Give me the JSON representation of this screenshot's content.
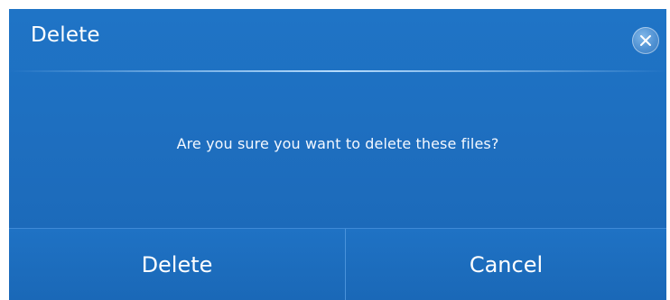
{
  "dialog": {
    "title": "Delete",
    "message": "Are you sure you want to delete these files?",
    "close_icon": "close-circle-icon",
    "buttons": {
      "delete_label": "Delete",
      "cancel_label": "Cancel"
    }
  },
  "colors": {
    "background": "#1e6fc0",
    "text": "#ffffff",
    "divider": "#a0cdf5"
  }
}
